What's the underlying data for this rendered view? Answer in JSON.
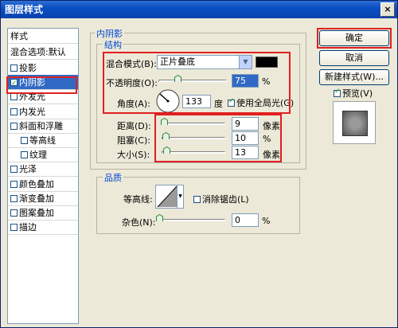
{
  "window": {
    "title": "图层样式",
    "close_glyph": "×"
  },
  "left_panel": {
    "header": "样式",
    "blend_options": "混合选项:默认",
    "items": [
      {
        "label": "投影",
        "checked": false,
        "indent": false
      },
      {
        "label": "内阴影",
        "checked": true,
        "indent": false,
        "selected": true
      },
      {
        "label": "外发光",
        "checked": false,
        "indent": false
      },
      {
        "label": "内发光",
        "checked": false,
        "indent": false
      },
      {
        "label": "斜面和浮雕",
        "checked": false,
        "indent": false
      },
      {
        "label": "等高线",
        "checked": false,
        "indent": true
      },
      {
        "label": "纹理",
        "checked": false,
        "indent": true
      },
      {
        "label": "光泽",
        "checked": false,
        "indent": false
      },
      {
        "label": "颜色叠加",
        "checked": false,
        "indent": false
      },
      {
        "label": "渐变叠加",
        "checked": false,
        "indent": false
      },
      {
        "label": "图案叠加",
        "checked": false,
        "indent": false
      },
      {
        "label": "描边",
        "checked": false,
        "indent": false
      }
    ]
  },
  "inner_shadow": {
    "legend": "内阴影",
    "structure_legend": "结构",
    "blend_mode_label": "混合模式(B):",
    "blend_mode_value": "正片叠底",
    "color": "#000000",
    "opacity_label": "不透明度(O):",
    "opacity_value": "75",
    "opacity_unit": "%",
    "angle_label": "角度(A):",
    "angle_value": "133",
    "angle_unit": "度",
    "global_light_label": "使用全局光(G)",
    "distance_label": "距离(D):",
    "distance_value": "9",
    "distance_unit": "像素",
    "choke_label": "阻塞(C):",
    "choke_value": "10",
    "choke_unit": "%",
    "size_label": "大小(S):",
    "size_value": "13",
    "size_unit": "像素"
  },
  "quality": {
    "legend": "品质",
    "contour_label": "等高线:",
    "antialias_label": "消除锯齿(L)",
    "noise_label": "杂色(N):",
    "noise_value": "0",
    "noise_unit": "%"
  },
  "buttons": {
    "ok": "确定",
    "cancel": "取消",
    "new_style": "新建样式(W)...",
    "preview_label": "预览(V)"
  },
  "colors": {
    "accent": "#316ac5",
    "highlight_box": "#e02020",
    "title_bar": "#0a4ec2"
  }
}
